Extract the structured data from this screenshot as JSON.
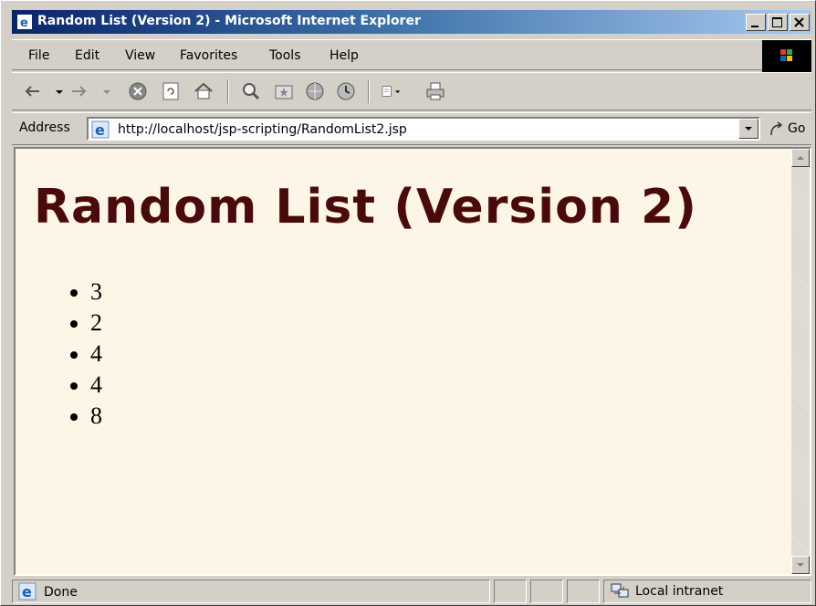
{
  "window": {
    "title": "Random List (Version 2) - Microsoft Internet Explorer"
  },
  "menu": {
    "items": [
      "File",
      "Edit",
      "View",
      "Favorites",
      "Tools",
      "Help"
    ]
  },
  "toolbar": {
    "icons": [
      "back-icon",
      "dropdown-icon",
      "forward-icon",
      "dropdown-icon",
      "stop-icon",
      "refresh-icon",
      "home-icon",
      "search-icon",
      "favorites-icon",
      "media-icon",
      "history-icon",
      "edit-icon",
      "print-icon"
    ]
  },
  "address": {
    "label": "Address",
    "url": "http://localhost/jsp-scripting/RandomList2.jsp",
    "go_label": "Go"
  },
  "page": {
    "heading": "Random List (Version 2)",
    "items": [
      "3",
      "2",
      "4",
      "4",
      "8"
    ]
  },
  "status": {
    "text": "Done",
    "zone": "Local intranet"
  },
  "colors": {
    "page_background": "#fdf5e6",
    "heading": "#4a0a0a",
    "titlebar_start": "#0a246a",
    "titlebar_end": "#a6caf0"
  }
}
